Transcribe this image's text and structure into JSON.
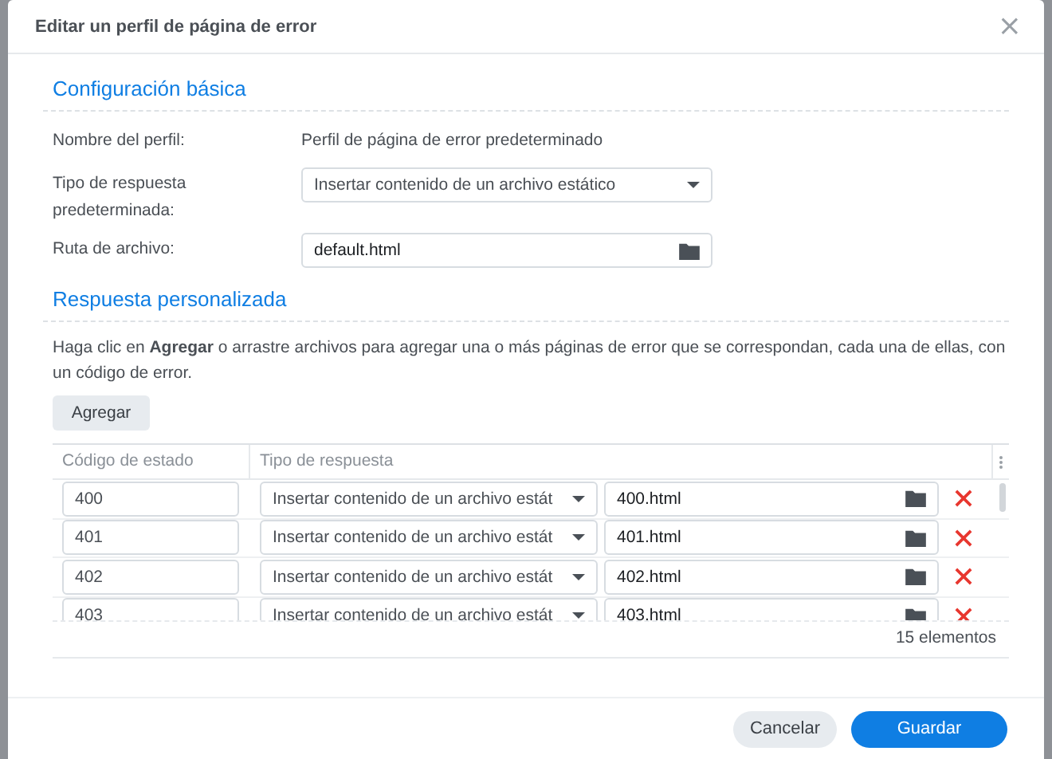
{
  "dialog": {
    "title": "Editar un perfil de página de error",
    "close": "×"
  },
  "basic": {
    "title": "Configuración básica",
    "fields": [
      {
        "kind": "text",
        "label": "Nombre del perfil:",
        "value": "Perfil de página de error predeterminado"
      },
      {
        "kind": "select",
        "label": "Tipo de respuesta predeterminada:",
        "value": "Insertar contenido de un archivo estático"
      },
      {
        "kind": "file",
        "label": "Ruta de archivo:",
        "value": "default.html"
      }
    ]
  },
  "custom": {
    "title": "Respuesta personalizada",
    "description": "Haga clic en **Agregar** o arrastre archivos para agregar una o más páginas de error que se correspondan, cada una de ellas, con un código de error.",
    "add_button": "Agregar",
    "table": {
      "columns": [
        "Código de estado",
        "Tipo de respuesta"
      ],
      "rows": [
        {
          "code": "400",
          "type": "Insertar contenido de un archivo estát",
          "file": "400.html"
        },
        {
          "code": "401",
          "type": "Insertar contenido de un archivo estát",
          "file": "401.html"
        },
        {
          "code": "402",
          "type": "Insertar contenido de un archivo estát",
          "file": "402.html"
        },
        {
          "code": "403",
          "type": "Insertar contenido de un archivo estát",
          "file": "403.html"
        }
      ],
      "count": "15 elementos"
    }
  },
  "buttons": [
    {
      "kind": "secondary",
      "label": "Cancelar"
    },
    {
      "kind": "primary",
      "label": "Guardar"
    }
  ]
}
